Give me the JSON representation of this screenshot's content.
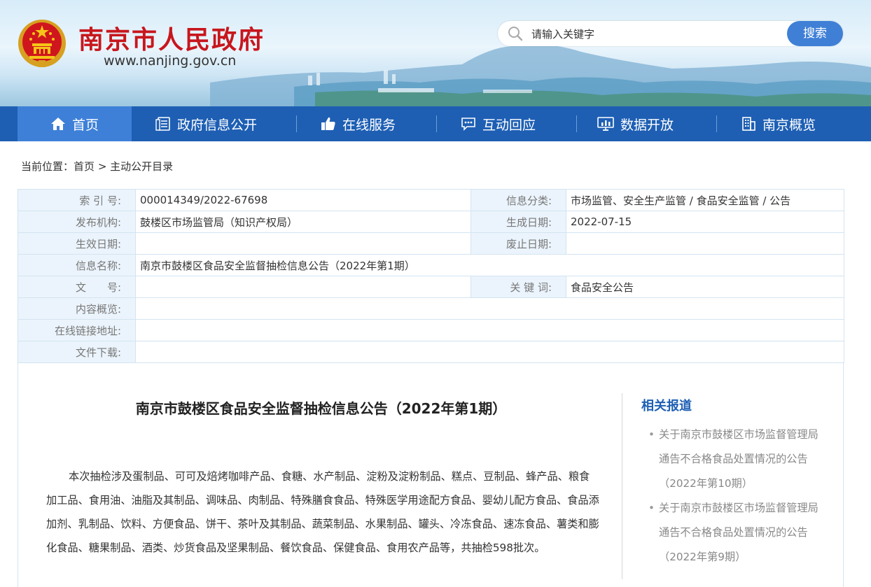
{
  "header": {
    "site_title": "南京市人民政府",
    "site_url": "www.nanjing.gov.cn",
    "search_placeholder": "请输入关键字",
    "search_button": "搜索"
  },
  "nav": {
    "items": [
      {
        "label": "首页",
        "icon": "home-icon",
        "active": true
      },
      {
        "label": "政府信息公开",
        "icon": "document-icon",
        "active": false
      },
      {
        "label": "在线服务",
        "icon": "thumbs-up-icon",
        "active": false
      },
      {
        "label": "互动回应",
        "icon": "chat-icon",
        "active": false
      },
      {
        "label": "数据开放",
        "icon": "monitor-chart-icon",
        "active": false
      },
      {
        "label": "南京概览",
        "icon": "building-icon",
        "active": false
      }
    ]
  },
  "breadcrumb": {
    "prefix": "当前位置：",
    "home": "首页",
    "separator": ">",
    "current": "主动公开目录"
  },
  "meta": {
    "index_no_label": "索 引 号:",
    "index_no": "000014349/2022-67698",
    "category_label": "信息分类:",
    "category": "市场监管、安全生产监管 / 食品安全监管 / 公告",
    "publisher_label": "发布机构:",
    "publisher": "鼓楼区市场监管局（知识产权局）",
    "created_label": "生成日期:",
    "created": "2022-07-15",
    "effective_label": "生效日期:",
    "effective": "",
    "abolished_label": "废止日期:",
    "abolished": "",
    "name_label": "信息名称:",
    "name": "南京市鼓楼区食品安全监督抽检信息公告（2022年第1期）",
    "doc_no_label": "文　　号:",
    "doc_no": "",
    "keywords_label": "关 键 词:",
    "keywords": "食品安全公告",
    "summary_label": "内容概览:",
    "summary": "",
    "link_label": "在线链接地址:",
    "link": "",
    "download_label": "文件下载:",
    "download": ""
  },
  "article": {
    "title": "南京市鼓楼区食品安全监督抽检信息公告（2022年第1期）",
    "body": "本次抽检涉及蛋制品、可可及焙烤咖啡产品、食糖、水产制品、淀粉及淀粉制品、糕点、豆制品、蜂产品、粮食加工品、食用油、油脂及其制品、调味品、肉制品、特殊膳食食品、特殊医学用途配方食品、婴幼儿配方食品、食品添加剂、乳制品、饮料、方便食品、饼干、茶叶及其制品、蔬菜制品、水果制品、罐头、冷冻食品、速冻食品、薯类和膨化食品、糖果制品、酒类、炒货食品及坚果制品、餐饮食品、保健食品、食用农产品等，共抽检598批次。"
  },
  "related": {
    "title": "相关报道",
    "items": [
      "关于南京市鼓楼区市场监督管理局通告不合格食品处置情况的公告（2022年第10期）",
      "关于南京市鼓楼区市场监督管理局通告不合格食品处置情况的公告（2022年第9期）"
    ]
  },
  "colors": {
    "brand_red": "#c8161d",
    "nav_blue": "#1e5fb4",
    "nav_active": "#3e80d8",
    "label_bg": "#ebf4fc",
    "search_button": "#3f7fd6"
  }
}
